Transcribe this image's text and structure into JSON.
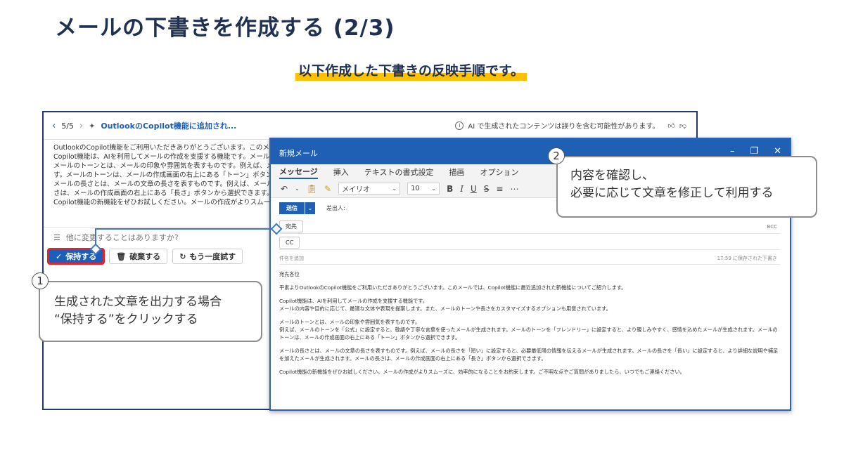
{
  "slide": {
    "title": "メールの下書きを作成する (2/3)",
    "subtitle": "以下作成した下書きの反映手順です。"
  },
  "copilot": {
    "nav_count": "5/5",
    "header_title": "OutlookのCopilot機能に追加され...",
    "ai_warning": "AI で生成されたコンテンツは誤りを含む可能性があります。",
    "body_lines": [
      "OutlookのCopilot機能をご利用いただきありがとうございます。このメールでは、Copilo",
      "Copilot機能は、AIを利用してメールの作成を支援する機能です。メールの内容や目的",
      "メールのトーンとは、メールの印象や雰囲気を表すものです。例えば、メールのトーンを「公",
      "す。メールのトーンは、メールの作成画面の右上にある「トーン」ボタンから選択できます。",
      "メールの長さとは、メールの文章の長さを表すものです。例えば、メールの長さを「短い」",
      "さは、メールの作成画面の右上にある「長さ」ボタンから選択できます。",
      "Copilot機能の新機能をぜひお試しください。メールの作成がよりスムーズに、効率的に"
    ],
    "prompt_placeholder": "他に変更することはありますか?",
    "keep_button": "保持する",
    "discard_button": "破棄する",
    "retry_button": "もう一度試す"
  },
  "compose": {
    "window_title": "新規メール",
    "tabs": [
      "メッセージ",
      "挿入",
      "テキストの書式設定",
      "描画",
      "オプション"
    ],
    "font_name": "メイリオ",
    "font_size": "10",
    "send_label": "送信",
    "from_label": "差出人:",
    "to_label": "宛先",
    "cc_label": "CC",
    "bcc_label": "BCC",
    "subject_placeholder": "件名を追加",
    "saved_status": "17:59 に保存された下書き",
    "body": {
      "greeting": "宛先各位",
      "p1": "平素よりOutlookのCopilot機能をご利用いただきありがとうございます。このメールでは、Copilot機能に最近追加された新機能についてご紹介します。",
      "p2_1": "Copilot機能は、AIを利用してメールの作成を支援する機能です。",
      "p2_2": "メールの内容や目的に応じて、最適な文体や表現を提案します。また、メールのトーンや長さをカスタマイズするオプションも用意されています。",
      "p3_1": "メールのトーンとは、メールの印象や雰囲気を表すものです。",
      "p3_2": "例えば、メールのトーンを「公式」に設定すると、敬語や丁寧な言葉を使ったメールが生成されます。メールのトーンを「フレンドリー」に設定すると、より親しみやすく、感情を込めたメールが生成されます。メールのトーンは、メールの作成画面の右上にある「トーン」ボタンから選択できます。",
      "p4": "メールの長さとは、メールの文章の長さを表すものです。例えば、メールの長さを「短い」に設定すると、必要最低限の情報を伝えるメールが生成されます。メールの長さを「長い」に設定すると、より詳細な説明や補足を加えたメールが生成されます。メールの長さは、メールの作成画面の右上にある「長さ」ボタンから選択できます。",
      "p5": "Copilot機能の新機能をぜひお試しください。メールの作成がよりスムーズに、効率的になることをお約束します。ご不明な点やご質問がありましたら、いつでもご連絡ください。"
    }
  },
  "callouts": {
    "one": {
      "number": "1",
      "line1": "生成された文章を出力する場合",
      "line2": "“保持する”をクリックする"
    },
    "two": {
      "number": "2",
      "line1": "内容を確認し、",
      "line2": "必要に応じて文章を修正して利用する"
    }
  },
  "colors": {
    "title": "#1f3050",
    "highlight": "#ffc000",
    "outlook_blue": "#1f5fb4",
    "red_outline": "#e5232b"
  }
}
